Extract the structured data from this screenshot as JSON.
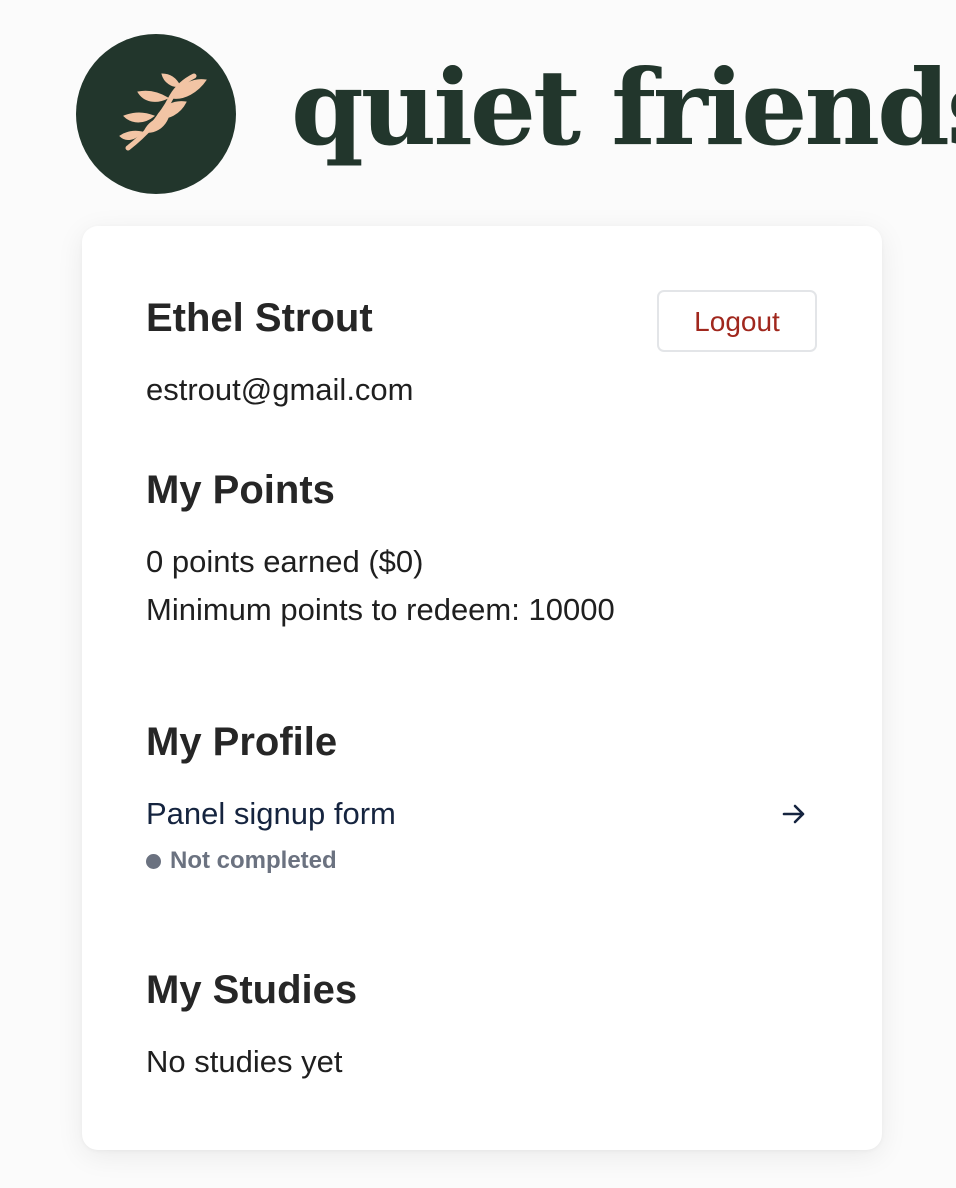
{
  "brand": {
    "name": "quiet friends",
    "logo_icon": "leaf-sprig-icon",
    "logo_bg_color": "#22362c",
    "logo_leaf_color": "#f2c4a4"
  },
  "user": {
    "name": "Ethel Strout",
    "email": "estrout@gmail.com"
  },
  "actions": {
    "logout_label": "Logout"
  },
  "points": {
    "title": "My Points",
    "earned_text": "0 points earned ($0)",
    "minimum_text": "Minimum points to redeem: 10000"
  },
  "profile": {
    "title": "My Profile",
    "form_label": "Panel signup form",
    "form_status": "Not completed",
    "arrow_icon": "arrow-right-icon"
  },
  "studies": {
    "title": "My Studies",
    "empty_text": "No studies yet"
  },
  "colors": {
    "accent_red": "#a0271d",
    "brand_green": "#22362c",
    "link_navy": "#15243f",
    "muted_gray": "#6b7280"
  }
}
